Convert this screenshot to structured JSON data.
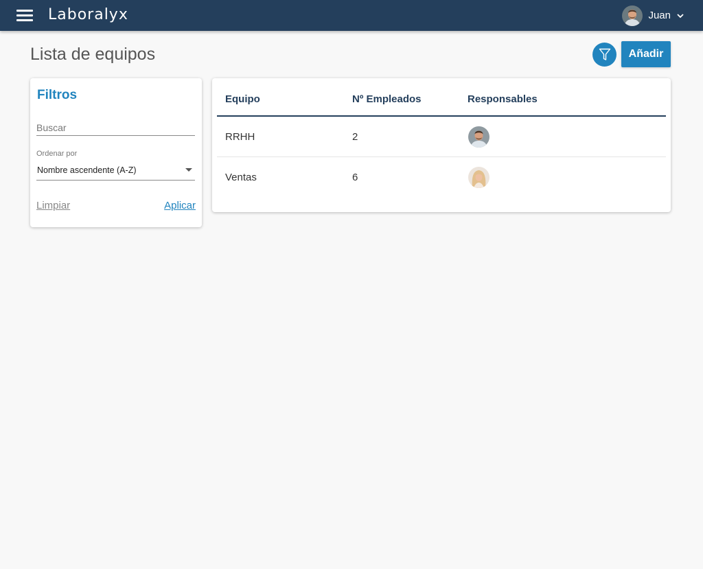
{
  "app": {
    "name": "Laboralyx",
    "user_name": "Juan"
  },
  "page": {
    "title": "Lista de equipos",
    "add_label": "Añadir"
  },
  "filters": {
    "title": "Filtros",
    "search_placeholder": "Buscar",
    "search_value": "",
    "sort_label": "Ordenar por",
    "sort_value": "Nombre ascendente (A-Z)",
    "clear_label": "Limpiar",
    "apply_label": "Aplicar"
  },
  "table": {
    "columns": [
      "Equipo",
      "Nº Empleados",
      "Responsables"
    ],
    "rows": [
      {
        "team": "RRHH",
        "employees": "2",
        "manager_avatar": "man-avatar"
      },
      {
        "team": "Ventas",
        "employees": "6",
        "manager_avatar": "woman-avatar"
      }
    ]
  },
  "colors": {
    "topbar": "#243f5c",
    "accent": "#2184be",
    "background": "#f8f8f8"
  },
  "icons": {
    "menu": "hamburger-menu-icon",
    "filter": "filter-funnel-icon",
    "chevron": "chevron-down-icon",
    "caret": "caret-down-icon"
  }
}
